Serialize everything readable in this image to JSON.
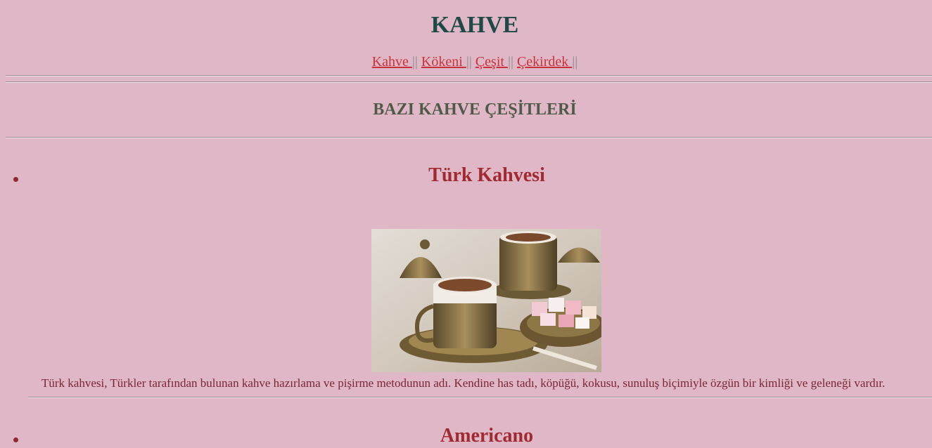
{
  "header": {
    "title": "KAHVE"
  },
  "nav": {
    "items": [
      {
        "label": "Kahve "
      },
      {
        "label": "Kökeni "
      },
      {
        "label": "Çeşit "
      },
      {
        "label": "Çekirdek "
      }
    ],
    "separator": "||"
  },
  "section": {
    "title": "BAZI KAHVE ÇEŞİTLERİ"
  },
  "coffees": [
    {
      "name": "Türk Kahvesi",
      "description": "Türk kahvesi, Türkler tarafından bulunan kahve hazırlama ve pişirme metodunun adı. Kendine has tadı, köpüğü, kokusu, sunuluş biçimiyle özgün bir kimliği ve geleneği vardır."
    },
    {
      "name": "Americano"
    }
  ],
  "colors": {
    "background": "#e0b7c6",
    "title": "#1d4a44",
    "link": "#c8343c",
    "section_title": "#4f5a48",
    "coffee_name": "#a02a30",
    "body_text": "#7a2636"
  }
}
